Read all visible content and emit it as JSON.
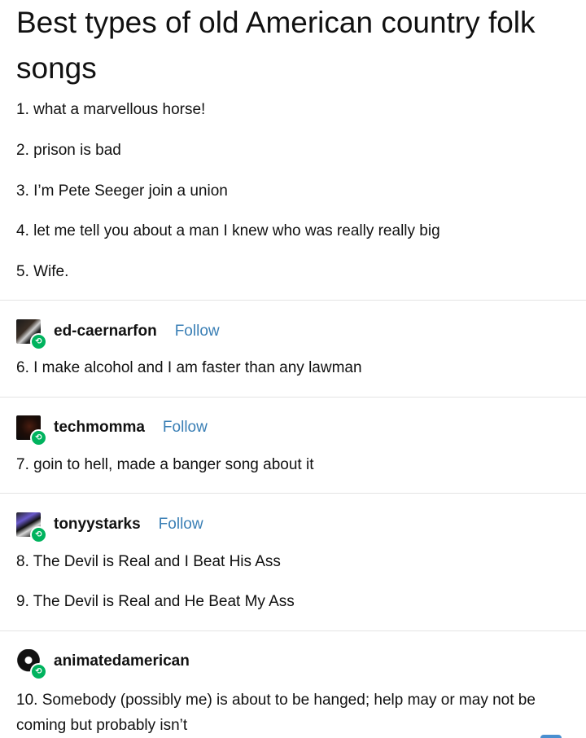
{
  "post": {
    "title": "Best types of old American country folk songs",
    "items": [
      "1. what a marvellous horse!",
      "2. prison is bad",
      "3. I’m Pete Seeger join a union",
      "4. let me tell you about a man I knew who was really really big",
      "5. Wife."
    ]
  },
  "reblogs": [
    {
      "username": "ed-caernarfon",
      "follow_label": "Follow",
      "items": [
        "6. I make alcohol and I am faster than any lawman"
      ]
    },
    {
      "username": "techmomma",
      "follow_label": "Follow",
      "items": [
        "7. goin to hell, made a banger song about it"
      ]
    },
    {
      "username": "tonyystarks",
      "follow_label": "Follow",
      "items": [
        "8. The Devil is Real and I Beat His Ass",
        "9. The Devil is Real and He Beat My Ass"
      ]
    },
    {
      "username": "animatedamerican",
      "items": [
        "10. Somebody (possibly me) is about to be hanged; help may or may not be coming but probably isn’t"
      ]
    }
  ],
  "colors": {
    "follow": "#3a7fb5",
    "reblog_badge": "#00b35e",
    "divider": "#e4e4e4"
  },
  "icons": {
    "reblog_badge": "reblog-icon"
  }
}
